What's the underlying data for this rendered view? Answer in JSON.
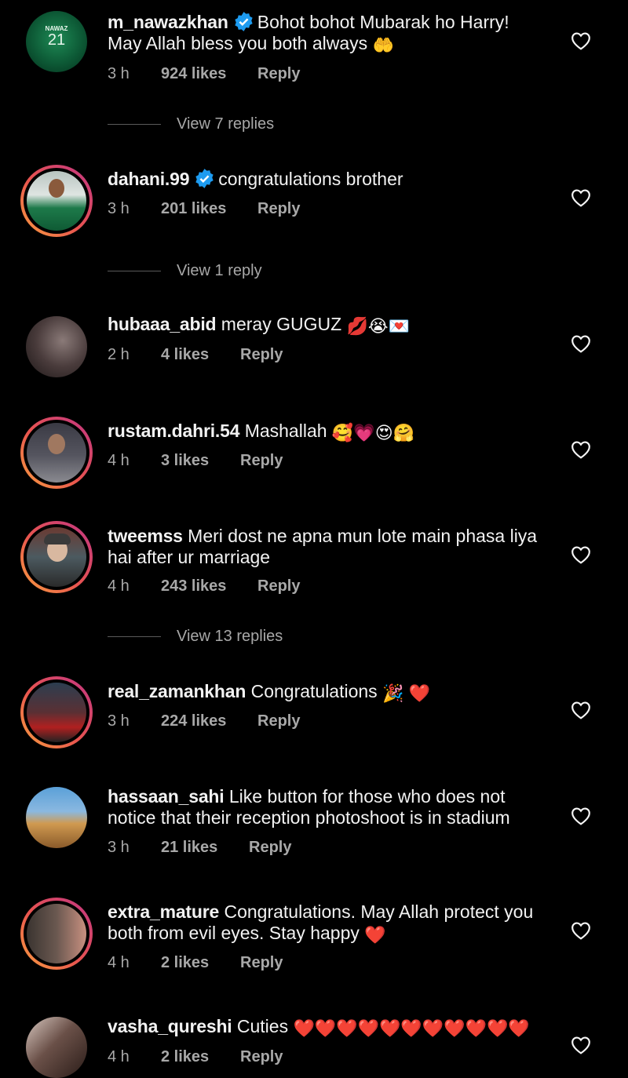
{
  "comments": [
    {
      "username": "m_nawazkhan",
      "verified": true,
      "text": "Bohot bohot Mubarak ho Harry!\nMay Allah bless you both always",
      "emoji": "🤲",
      "time": "3 h",
      "likes": "924 likes",
      "reply": "Reply",
      "view_replies": "View 7 replies"
    },
    {
      "username": "dahani.99",
      "verified": true,
      "text": "congratulations brother",
      "emoji": "",
      "time": "3 h",
      "likes": "201 likes",
      "reply": "Reply",
      "view_replies": "View 1 reply"
    },
    {
      "username": "hubaaa_abid",
      "verified": false,
      "text": "meray GUGUZ",
      "emoji": "💋😭💌",
      "time": "2 h",
      "likes": "4 likes",
      "reply": "Reply"
    },
    {
      "username": "rustam.dahri.54",
      "verified": false,
      "text": "Mashallah",
      "emoji": "🥰💗😍🤗",
      "time": "4 h",
      "likes": "3 likes",
      "reply": "Reply"
    },
    {
      "username": "tweemss",
      "verified": false,
      "text": "Meri dost ne apna mun lote main phasa liya hai after ur marriage",
      "emoji": "",
      "time": "4 h",
      "likes": "243 likes",
      "reply": "Reply",
      "view_replies": "View 13 replies"
    },
    {
      "username": "real_zamankhan",
      "verified": false,
      "text": "Congratulations",
      "emoji": "🎉 ❤️",
      "time": "3 h",
      "likes": "224 likes",
      "reply": "Reply"
    },
    {
      "username": "hassaan_sahi",
      "verified": false,
      "text": "Like button for those  who does not notice that their reception  photoshoot is in stadium",
      "emoji": "",
      "time": "3 h",
      "likes": "21 likes",
      "reply": "Reply"
    },
    {
      "username": "extra_mature",
      "verified": false,
      "text": "Congratulations. May Allah protect you both from evil eyes. Stay happy",
      "emoji": "❤️",
      "time": "4 h",
      "likes": "2 likes",
      "reply": "Reply"
    },
    {
      "username": "vasha_qureshi",
      "verified": false,
      "text": "Cuties",
      "emoji": "❤️❤️❤️❤️❤️❤️❤️❤️❤️❤️❤️",
      "time": "4 h",
      "likes": "2 likes",
      "reply": "Reply"
    }
  ],
  "avatar_jersey_number": "21",
  "avatar_jersey_name": "NAWAZ",
  "colors": {
    "background": "#000000",
    "text": "#f2f2f2",
    "muted": "#a8a8a8",
    "verified": "#1d9bf0",
    "heart": "#f5f5f5",
    "story_ring": [
      "#f9a03f",
      "#e8544f",
      "#c13584"
    ]
  },
  "icons": {
    "like": "heart-outline-icon",
    "verified": "verified-badge-icon"
  }
}
